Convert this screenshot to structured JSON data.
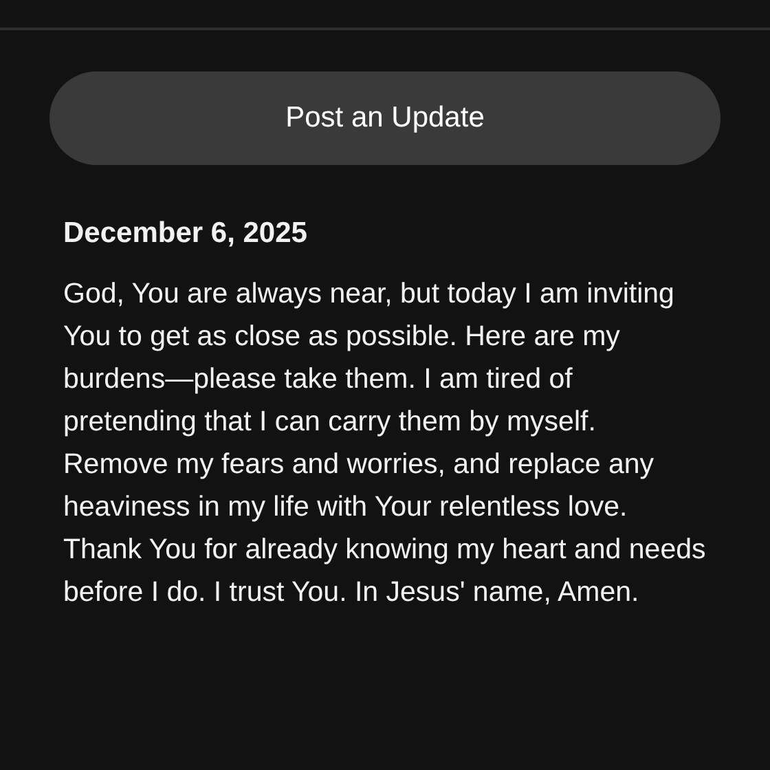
{
  "button": {
    "label": "Post an Update"
  },
  "entry": {
    "date": "December 6, 2025",
    "text": "God, You are always near, but today I am inviting You to get as close as possible. Here are my burdens—please take them. I am tired of pretending that I can carry them by myself. Remove my fears and worries, and replace any heaviness in my life with Your relentless love. Thank You for already knowing my heart and needs before I do. I trust You. In Jesus' name, Amen."
  }
}
